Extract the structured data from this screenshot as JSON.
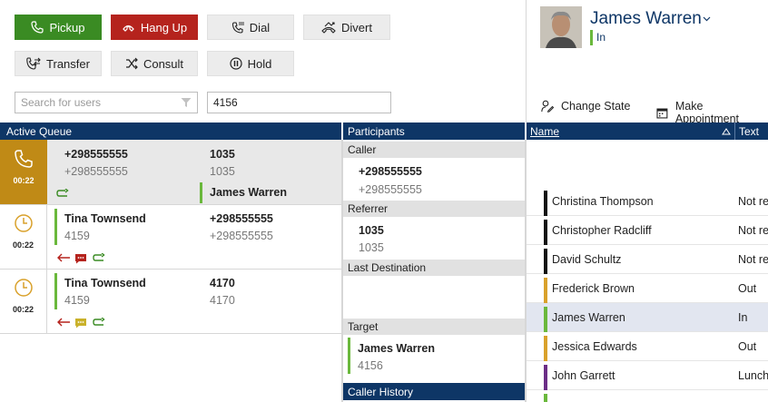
{
  "toolbar": {
    "pickup": "Pickup",
    "hangup": "Hang Up",
    "dial": "Dial",
    "divert": "Divert",
    "transfer": "Transfer",
    "consult": "Consult",
    "hold": "Hold"
  },
  "search": {
    "placeholder": "Search for users",
    "number_value": "4156"
  },
  "queue": {
    "header": "Active Queue",
    "items": [
      {
        "time": "00:22",
        "caller_main": "+298555555",
        "caller_sub": "+298555555",
        "dest_main": "1035",
        "dest_sub": "1035",
        "agent": "James Warren"
      },
      {
        "time": "00:22",
        "name": "Tina Townsend",
        "ext": "4159",
        "num_main": "+298555555",
        "num_sub": "+298555555"
      },
      {
        "time": "00:22",
        "name": "Tina Townsend",
        "ext": "4159",
        "num_main": "4170",
        "num_sub": "4170"
      }
    ]
  },
  "participants": {
    "header": "Participants",
    "caller_label": "Caller",
    "caller_main": "+298555555",
    "caller_sub": "+298555555",
    "referrer_label": "Referrer",
    "referrer_main": "1035",
    "referrer_sub": "1035",
    "last_dest_label": "Last Destination",
    "target_label": "Target",
    "target_main": "James Warren",
    "target_sub": "4156",
    "history_label": "Caller History"
  },
  "profile": {
    "name": "James Warren",
    "state": "In",
    "change_state": "Change State",
    "make_appointment": "Make Appointment"
  },
  "users": {
    "col_name": "Name",
    "col_text": "Text",
    "rows": [
      {
        "name": "Christina Thompson",
        "text": "Not re",
        "color": "#111111"
      },
      {
        "name": "Christopher Radcliff",
        "text": "Not re",
        "color": "#111111"
      },
      {
        "name": "David Schultz",
        "text": "Not re",
        "color": "#111111"
      },
      {
        "name": "Frederick Brown",
        "text": "Out",
        "color": "#d9a12b"
      },
      {
        "name": "James Warren",
        "text": "In",
        "color": "#6ab83c"
      },
      {
        "name": "Jessica Edwards",
        "text": "Out",
        "color": "#d9a12b"
      },
      {
        "name": "John Garrett",
        "text": "Lunch",
        "color": "#6b2d86"
      }
    ]
  },
  "colors": {
    "accent": "#0e3666",
    "green": "#3a8b23",
    "red": "#b5231d",
    "amber": "#d9a12b"
  }
}
